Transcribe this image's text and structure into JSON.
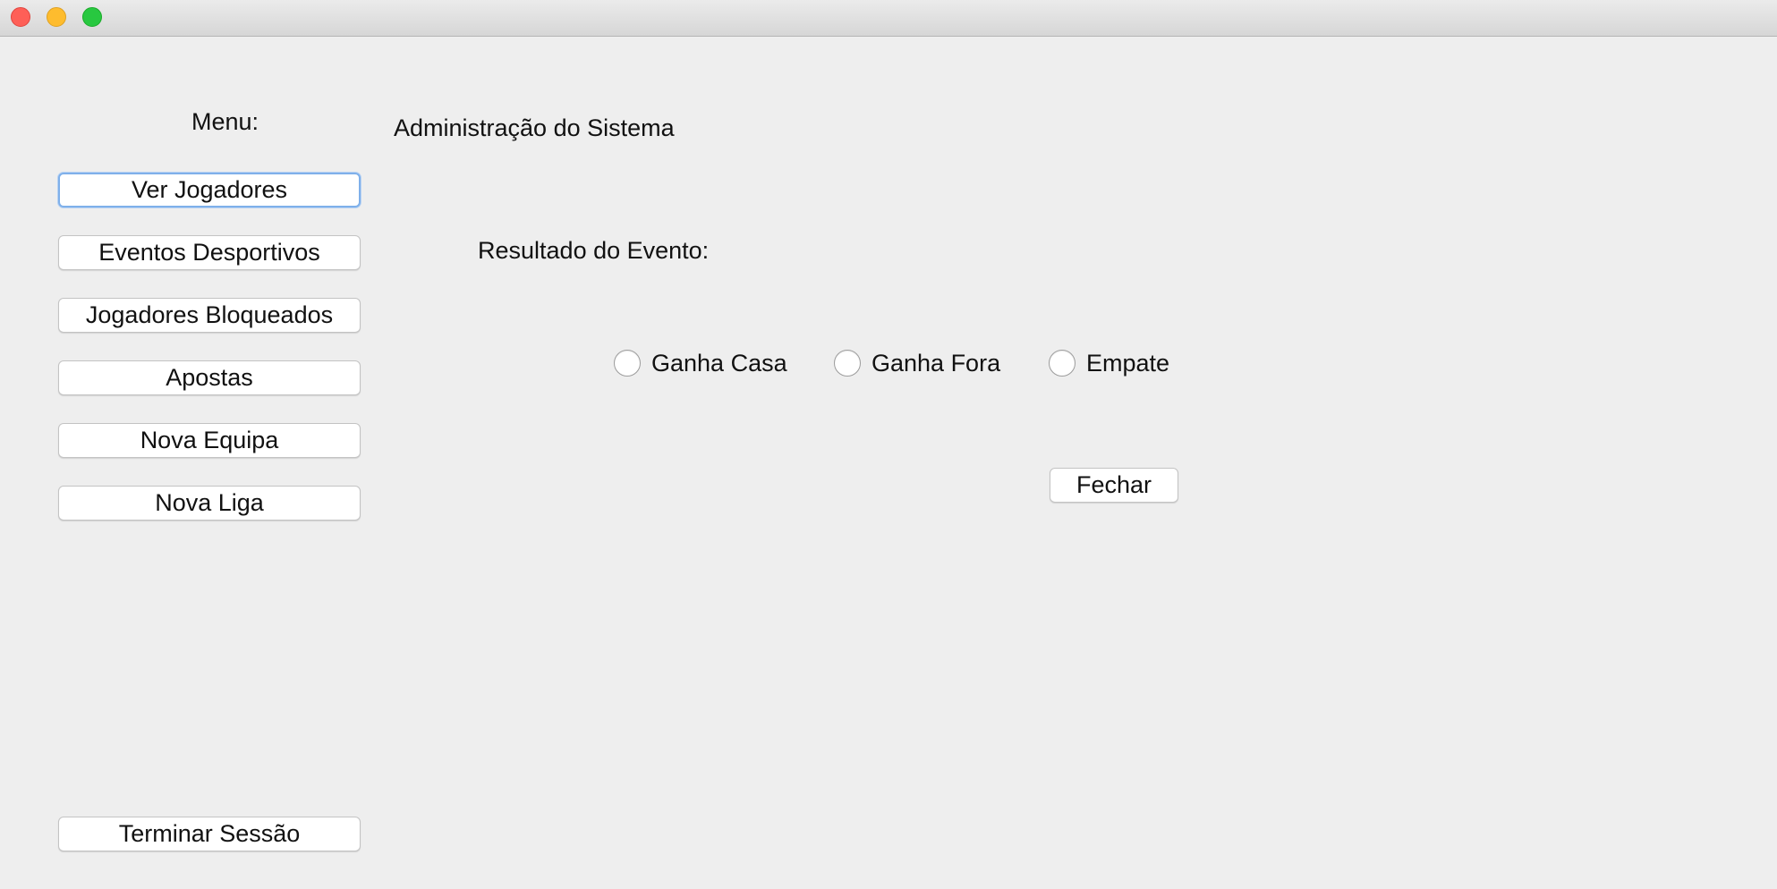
{
  "window": {
    "controls": {
      "close": "close",
      "minimize": "minimize",
      "maximize": "maximize"
    }
  },
  "sidebar": {
    "heading": "Menu:",
    "items": [
      {
        "label": "Ver Jogadores"
      },
      {
        "label": "Eventos Desportivos"
      },
      {
        "label": "Jogadores Bloqueados"
      },
      {
        "label": "Apostas"
      },
      {
        "label": "Nova Equipa"
      },
      {
        "label": "Nova Liga"
      }
    ],
    "logout_label": "Terminar Sessão"
  },
  "main": {
    "title": "Administração do Sistema",
    "result_label": "Resultado do Evento:",
    "options": [
      {
        "label": "Ganha Casa",
        "selected": false
      },
      {
        "label": "Ganha Fora",
        "selected": false
      },
      {
        "label": "Empate",
        "selected": false
      }
    ],
    "close_label": "Fechar"
  }
}
